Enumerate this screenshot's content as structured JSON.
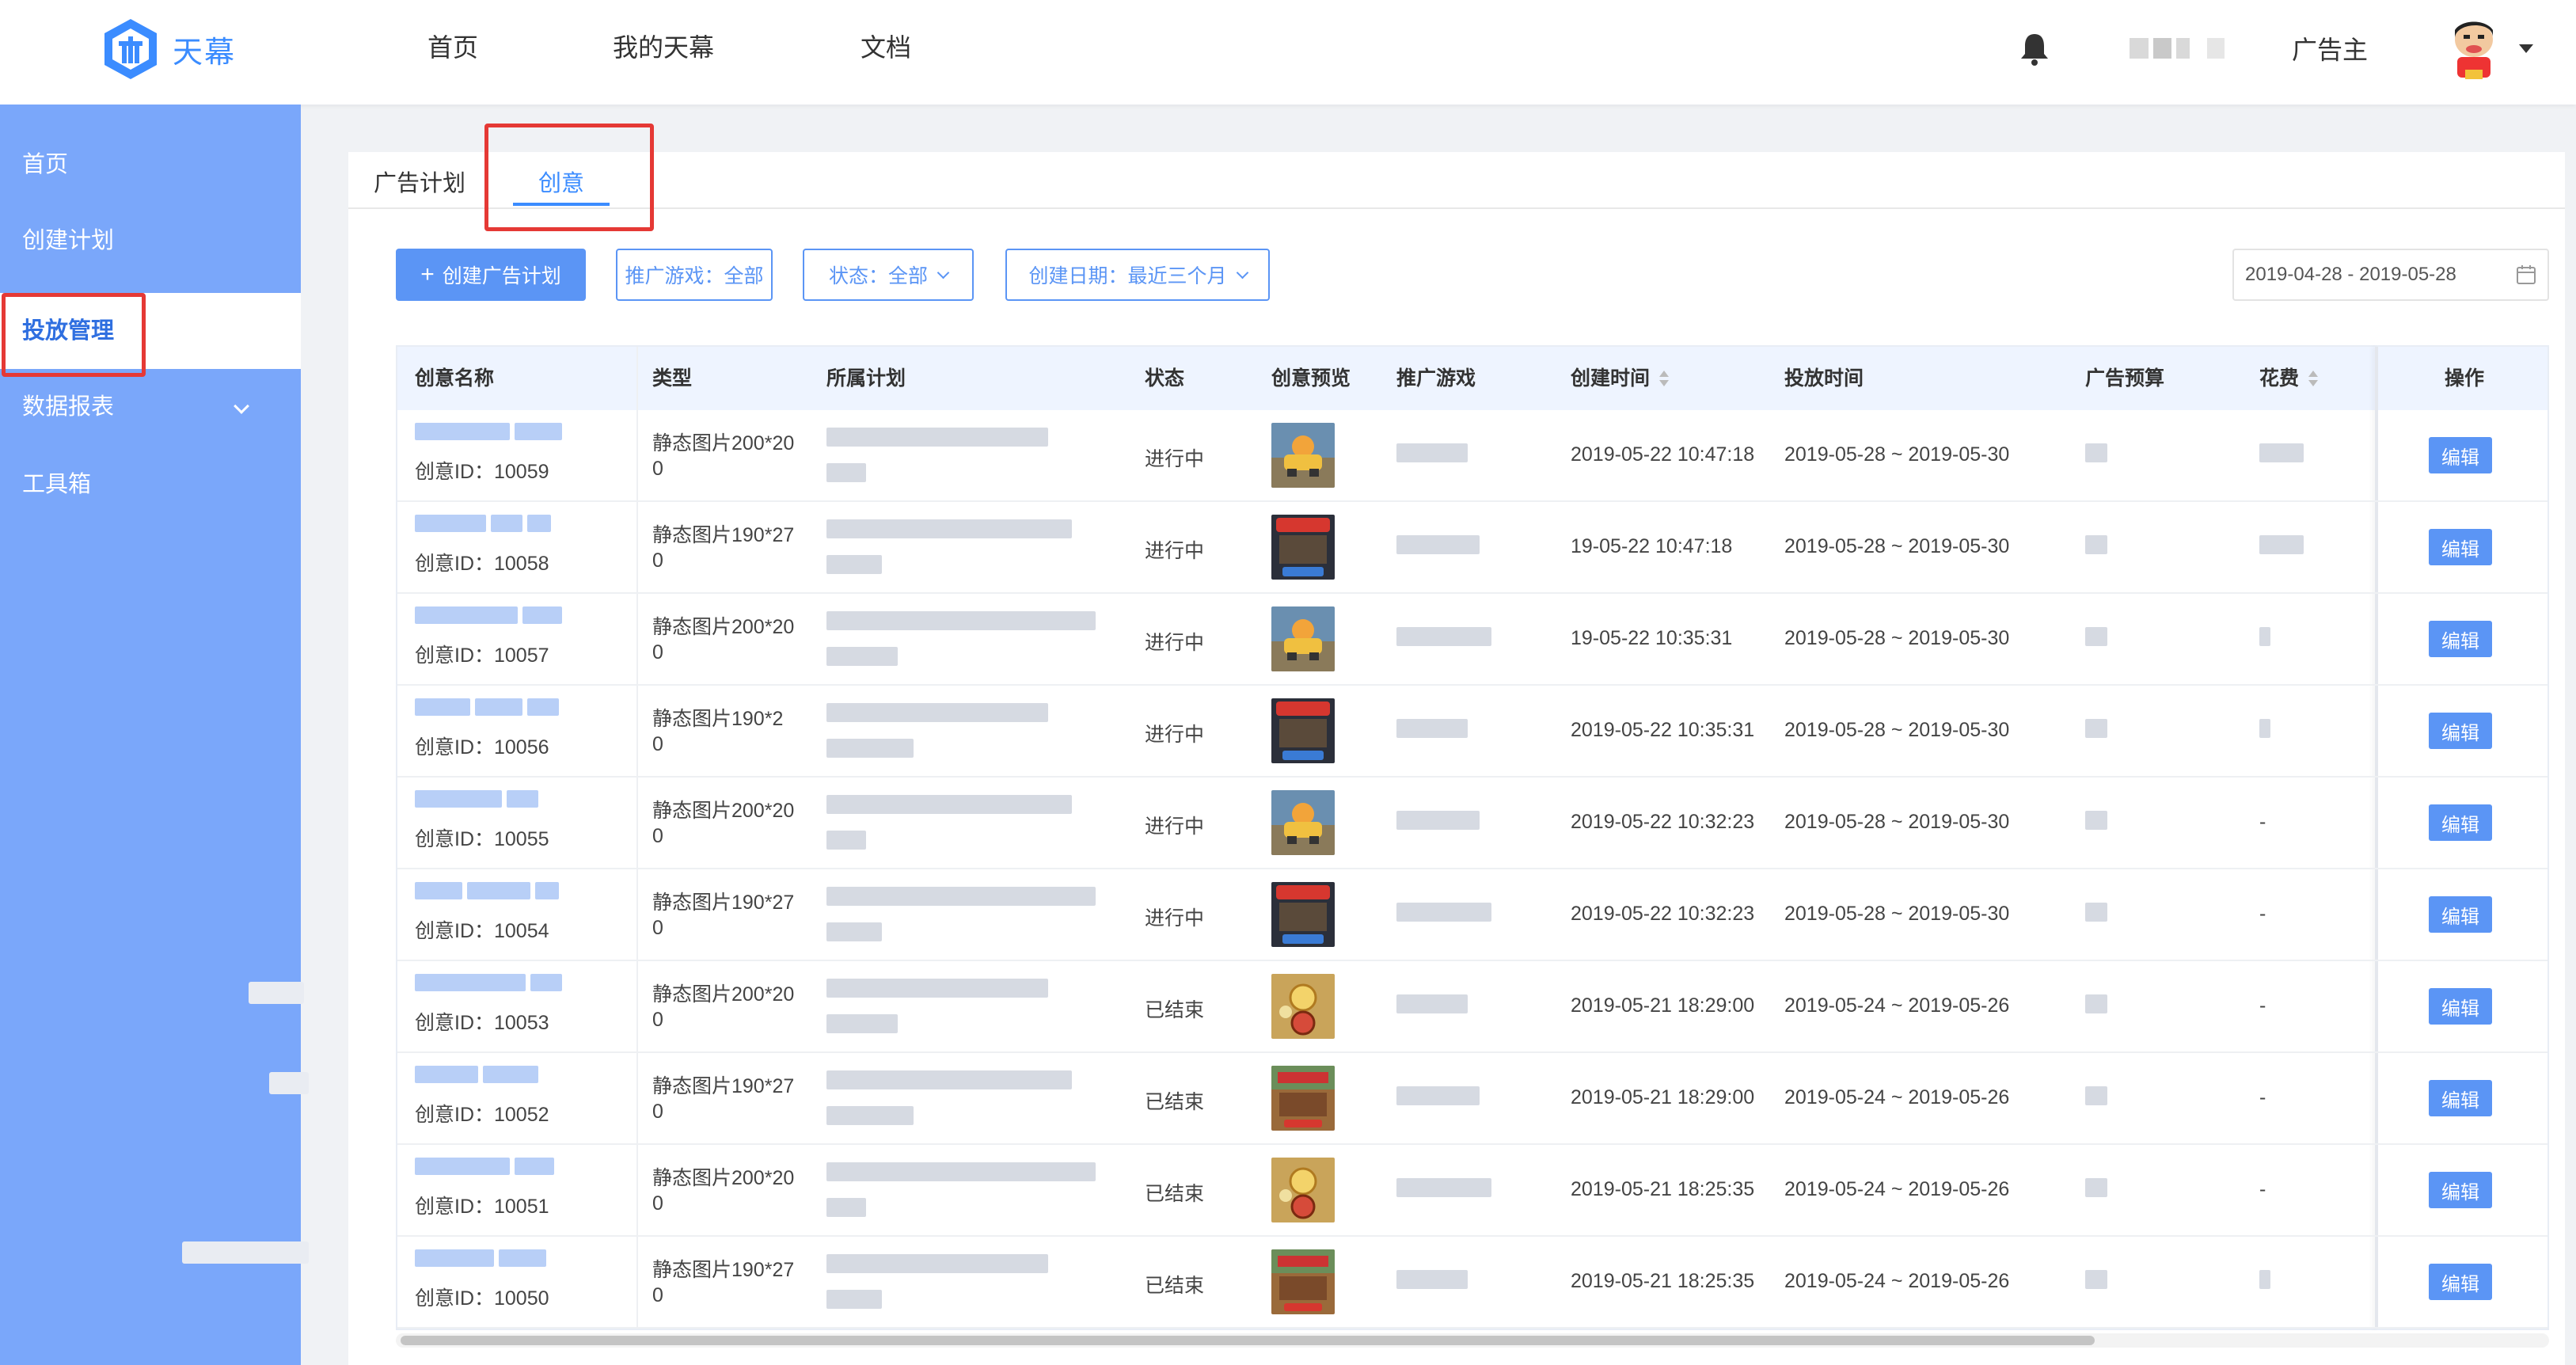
{
  "header": {
    "logo_text": "天幕",
    "nav": [
      "首页",
      "我的天幕",
      "文档"
    ],
    "role": "广告主"
  },
  "sidebar": {
    "items": [
      {
        "label": "首页"
      },
      {
        "label": "创建计划"
      },
      {
        "label": "投放管理",
        "active": true
      },
      {
        "label": "数据报表",
        "has_submenu": true
      },
      {
        "label": "工具箱"
      }
    ]
  },
  "tabs": [
    {
      "label": "广告计划"
    },
    {
      "label": "创意",
      "active": true
    }
  ],
  "toolbar": {
    "create_label": "创建广告计划",
    "filters": [
      "推广游戏：全部",
      "状态：全部",
      "创建日期：最近三个月"
    ],
    "date_range": "2019-04-28 - 2019-05-28"
  },
  "table": {
    "headers": [
      "创意名称",
      "类型",
      "所属计划",
      "状态",
      "创意预览",
      "推广游戏",
      "创建时间",
      "投放时间",
      "广告预算",
      "花费",
      "操作"
    ],
    "rows": [
      {
        "id_label": "创意ID：10059",
        "type": "静态图片200*20",
        "type_tail": "0",
        "status": "进行中",
        "created": "2019-05-22 10:47:18",
        "period": "2019-05-28 ~ 2019-05-30",
        "cost": "",
        "edit": "编辑",
        "thumb": "car"
      },
      {
        "id_label": "创意ID：10058",
        "type": "静态图片190*27",
        "type_tail": "0",
        "status": "进行中",
        "created": "19-05-22 10:47:18",
        "period": "2019-05-28 ~ 2019-05-30",
        "cost": "",
        "edit": "编辑",
        "thumb": "shooter"
      },
      {
        "id_label": "创意ID：10057",
        "type": "静态图片200*20",
        "type_tail": "0",
        "status": "进行中",
        "created": "19-05-22 10:35:31",
        "period": "2019-05-28 ~ 2019-05-30",
        "cost": "",
        "edit": "编辑",
        "thumb": "car"
      },
      {
        "id_label": "创意ID：10056",
        "type": "静态图片190*2",
        "type_tail": "0",
        "status": "进行中",
        "created": "2019-05-22 10:35:31",
        "period": "2019-05-28 ~ 2019-05-30",
        "cost": "",
        "edit": "编辑",
        "thumb": "shooter"
      },
      {
        "id_label": "创意ID：10055",
        "type": "静态图片200*20",
        "type_tail": "0",
        "status": "进行中",
        "created": "2019-05-22 10:32:23",
        "period": "2019-05-28 ~ 2019-05-30",
        "cost": "-",
        "edit": "编辑",
        "thumb": "car"
      },
      {
        "id_label": "创意ID：10054",
        "type": "静态图片190*27",
        "type_tail": "0",
        "status": "进行中",
        "created": "2019-05-22 10:32:23",
        "period": "2019-05-28 ~ 2019-05-30",
        "cost": "-",
        "edit": "编辑",
        "thumb": "shooter"
      },
      {
        "id_label": "创意ID：10053",
        "type": "静态图片200*20",
        "type_tail": "0",
        "status": "已结束",
        "created": "2019-05-21 18:29:00",
        "period": "2019-05-24 ~ 2019-05-26",
        "cost": "-",
        "edit": "编辑",
        "thumb": "coin"
      },
      {
        "id_label": "创意ID：10052",
        "type": "静态图片190*27",
        "type_tail": "0",
        "status": "已结束",
        "created": "2019-05-21 18:29:00",
        "period": "2019-05-24 ~ 2019-05-26",
        "cost": "-",
        "edit": "编辑",
        "thumb": "battle"
      },
      {
        "id_label": "创意ID：10051",
        "type": "静态图片200*20",
        "type_tail": "0",
        "status": "已结束",
        "created": "2019-05-21 18:25:35",
        "period": "2019-05-24 ~ 2019-05-26",
        "cost": "-",
        "edit": "编辑",
        "thumb": "coin"
      },
      {
        "id_label": "创意ID：10050",
        "type": "静态图片190*27",
        "type_tail": "0",
        "status": "已结束",
        "created": "2019-05-21 18:25:35",
        "period": "2019-05-24 ~ 2019-05-26",
        "cost": "",
        "edit": "编辑",
        "thumb": "battle"
      }
    ]
  },
  "colors": {
    "accent": "#3b8cff",
    "sidebar": "#7aa7fa",
    "highlight": "#e53935"
  }
}
